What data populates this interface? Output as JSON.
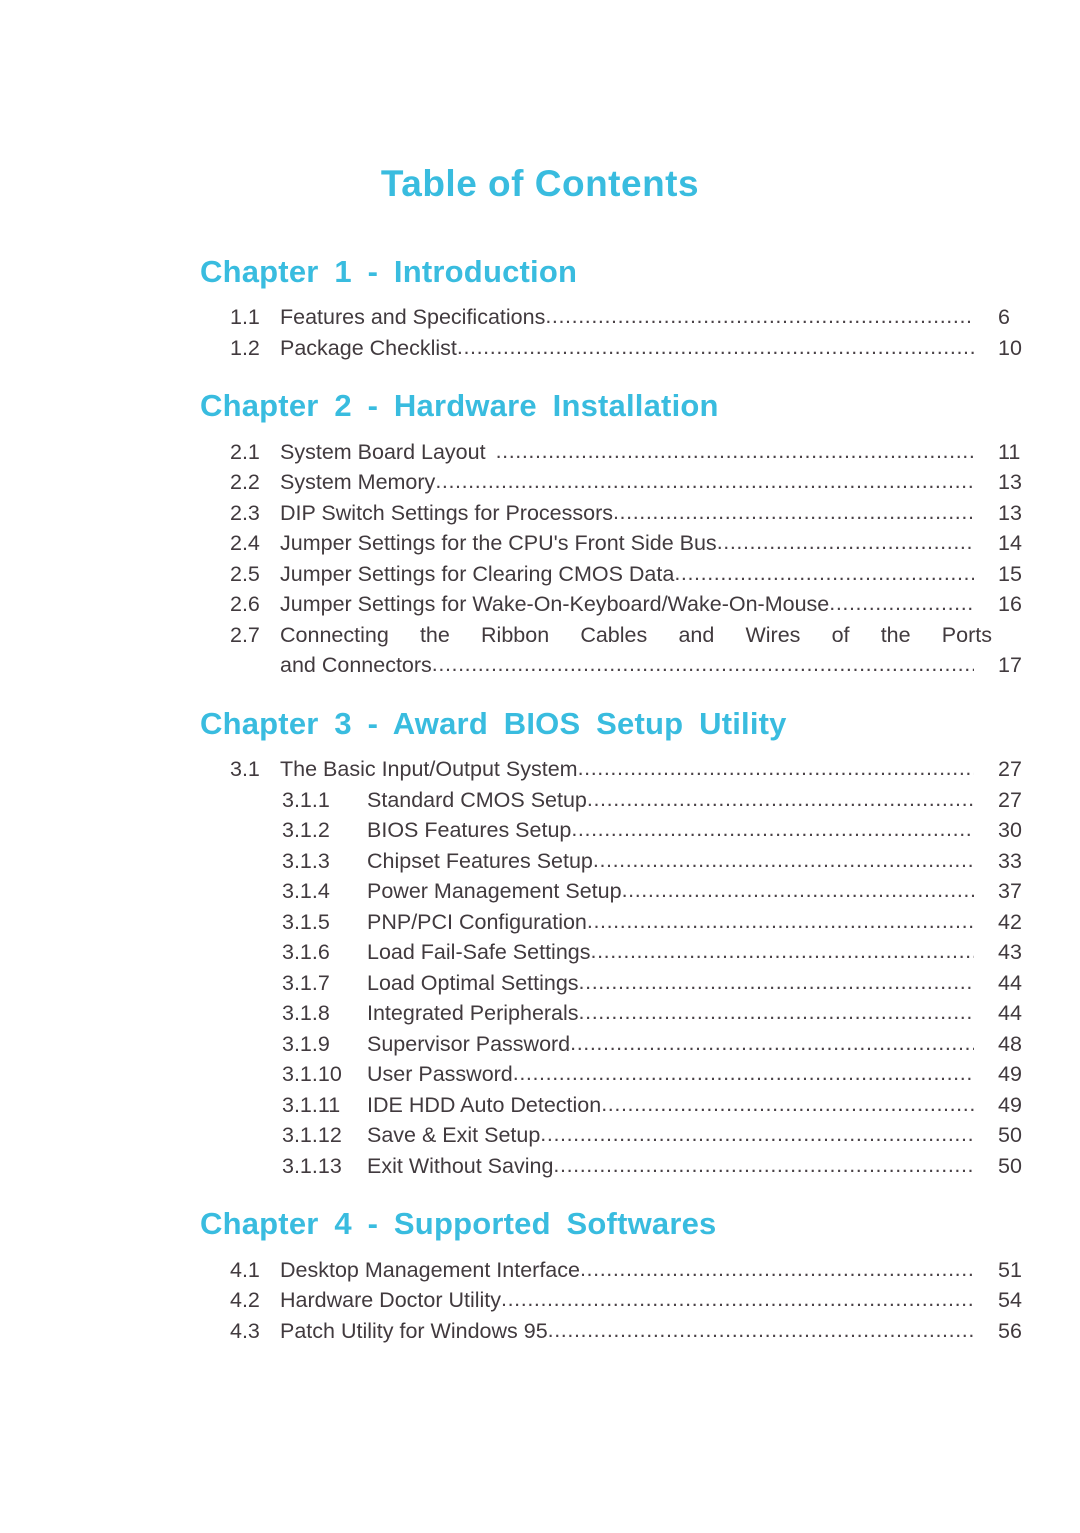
{
  "document": {
    "title": "Table of Contents"
  },
  "colors": {
    "accent": "#39bcdf",
    "body_text": "#413a3e",
    "background": "#ffffff"
  },
  "chapters": [
    {
      "heading": "Chapter 1 - Introduction",
      "entries": [
        {
          "number": "1.1",
          "title": "Features and Specifications",
          "page": "6"
        },
        {
          "number": "1.2",
          "title": "Package Checklist",
          "page": "10"
        }
      ]
    },
    {
      "heading": "Chapter 2 - Hardware Installation",
      "entries": [
        {
          "number": "2.1",
          "title": "System Board Layout",
          "page": "11",
          "space_before_leader": true
        },
        {
          "number": "2.2",
          "title": "System Memory",
          "page": "13"
        },
        {
          "number": "2.3",
          "title": "DIP Switch Settings for Processors",
          "page": "13"
        },
        {
          "number": "2.4",
          "title": "Jumper Settings for the CPU's Front Side Bus",
          "page": "14"
        },
        {
          "number": "2.5",
          "title": "Jumper Settings for Clearing CMOS Data",
          "page": "15"
        },
        {
          "number": "2.6",
          "title": "Jumper Settings for Wake-On-Keyboard/Wake-On-Mouse",
          "page": "16"
        },
        {
          "number": "2.7",
          "multiline": true,
          "line1_words": [
            "Connecting",
            "the",
            "Ribbon",
            "Cables",
            "and",
            "Wires",
            "of",
            "the",
            "Ports"
          ],
          "line2": "and Connectors",
          "page": "17"
        }
      ]
    },
    {
      "heading": "Chapter 3 - Award BIOS Setup Utility",
      "entries": [
        {
          "number": "3.1",
          "title": "The Basic Input/Output System",
          "page": "27",
          "level": 1
        },
        {
          "number": "3.1.1",
          "title": "Standard CMOS Setup",
          "page": "27",
          "level": 2
        },
        {
          "number": "3.1.2",
          "title": "BIOS Features Setup",
          "page": "30",
          "level": 2
        },
        {
          "number": "3.1.3",
          "title": "Chipset Features Setup",
          "page": "33",
          "level": 2
        },
        {
          "number": "3.1.4",
          "title": "Power Management Setup",
          "page": "37",
          "level": 2
        },
        {
          "number": "3.1.5",
          "title": "PNP/PCI Configuration",
          "page": "42",
          "level": 2
        },
        {
          "number": "3.1.6",
          "title": "Load Fail-Safe Settings",
          "page": "43",
          "level": 2
        },
        {
          "number": "3.1.7",
          "title": "Load Optimal Settings",
          "page": "44",
          "level": 2
        },
        {
          "number": "3.1.8",
          "title": "Integrated Peripherals",
          "page": "44",
          "level": 2
        },
        {
          "number": "3.1.9",
          "title": "Supervisor Password",
          "page": "48",
          "level": 2
        },
        {
          "number": "3.1.10",
          "title": "User Password",
          "page": "49",
          "level": 2
        },
        {
          "number": "3.1.11",
          "title": "IDE HDD Auto Detection",
          "page": "49",
          "level": 2
        },
        {
          "number": "3.1.12",
          "title": "Save & Exit Setup",
          "page": "50",
          "level": 2
        },
        {
          "number": "3.1.13",
          "title": "Exit Without Saving",
          "page": "50",
          "level": 2
        }
      ]
    },
    {
      "heading": "Chapter 4 - Supported Softwares",
      "entries": [
        {
          "number": "4.1",
          "title": "Desktop Management Interface",
          "page": "51"
        },
        {
          "number": "4.2",
          "title": "Hardware Doctor Utility",
          "page": "54"
        },
        {
          "number": "4.3",
          "title": "Patch Utility for Windows 95",
          "page": "56"
        }
      ]
    }
  ]
}
